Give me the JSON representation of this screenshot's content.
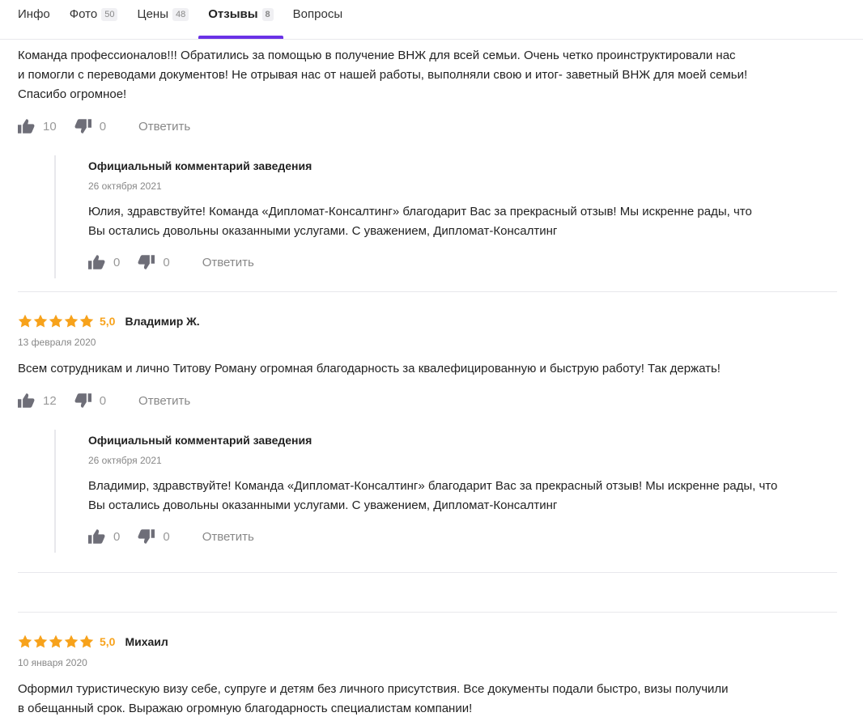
{
  "tabs": [
    {
      "label": "Инфо",
      "count": ""
    },
    {
      "label": "Фото",
      "count": "50"
    },
    {
      "label": "Цены",
      "count": "48"
    },
    {
      "label": "Отзывы",
      "count": "8"
    },
    {
      "label": "Вопросы",
      "count": ""
    }
  ],
  "active_tab": "Отзывы",
  "reply_label": "Ответить",
  "official_title": "Официальный комментарий заведения",
  "colors": {
    "accent": "#6a32e6",
    "star": "#f7a21b"
  },
  "review1": {
    "text_lines": [
      "Команда профессионалов!!! Обратились за помощью в получение ВНЖ для всей семьи. Очень четко проинструктировали нас",
      "и помогли с переводами документов! Не отрывая нас от нашей работы, выполняли свою и итог- заветный ВНЖ для моей семьи!",
      "Спасибо огромное!"
    ],
    "likes": "10",
    "dislikes": "0",
    "official": {
      "date": "26 октября 2021",
      "text_lines": [
        "Юлия, здравствуйте! Команда «Дипломат-Консалтинг» благодарит Вас за прекрасный отзыв! Мы искренне рады, что",
        "Вы остались довольны оказанными услугами. С уважением, Дипломат-Консалтинг"
      ],
      "likes": "0",
      "dislikes": "0"
    }
  },
  "review2": {
    "rating": "5,0",
    "stars": 5,
    "author": "Владимир Ж.",
    "date": "13 февраля 2020",
    "text": "Всем сотрудникам и лично Титову Роману огромная благодарность за квалефицированную и быструю работу! Так держать!",
    "likes": "12",
    "dislikes": "0",
    "official": {
      "date": "26 октября 2021",
      "text_lines": [
        "Владимир, здравствуйте! Команда «Дипломат-Консалтинг» благодарит Вас за прекрасный отзыв! Мы искренне рады, что",
        "Вы остались довольны оказанными услугами. С уважением, Дипломат-Консалтинг"
      ],
      "likes": "0",
      "dislikes": "0"
    }
  },
  "review3": {
    "rating": "5,0",
    "stars": 5,
    "author": "Михаил",
    "date": "10 января 2020",
    "text_lines": [
      "Оформил туристическую визу себе, супруге и детям без личного присутствия. Все документы подали быстро, визы получили",
      "в обещанный срок. Выражаю огромную благодарность специалистам компании!"
    ]
  }
}
